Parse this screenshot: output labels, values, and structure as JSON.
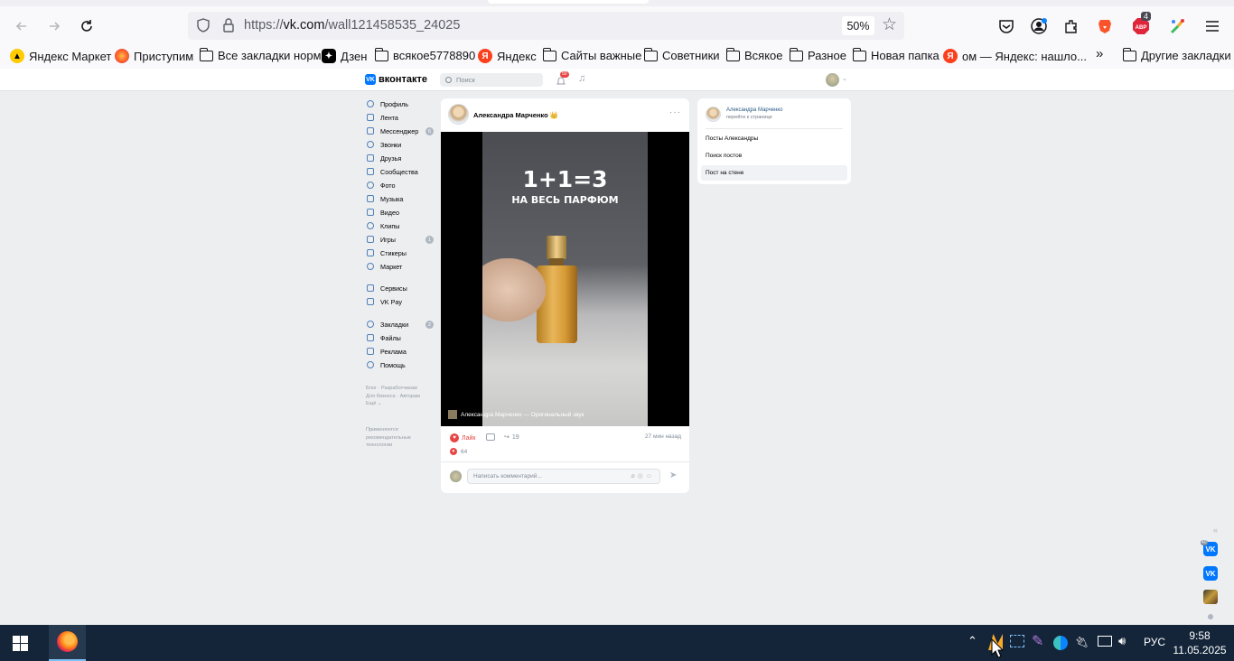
{
  "browser": {
    "url_prefix": "https://",
    "url_domain": "vk.com",
    "url_path": "/wall121458535_24025",
    "zoom": "50%",
    "bookmarks": [
      {
        "label": "Яндекс Маркет",
        "icon": "yandex-market-icon"
      },
      {
        "label": "Приступим",
        "icon": "firefox-icon"
      },
      {
        "label": "Все закладки норм",
        "icon": "folder-icon"
      },
      {
        "label": "Дзен",
        "icon": "dzen-icon"
      },
      {
        "label": "всякое5778890",
        "icon": "folder-icon"
      },
      {
        "label": "Яндекс",
        "icon": "yandex-icon"
      },
      {
        "label": "Сайты важные",
        "icon": "folder-icon"
      },
      {
        "label": "Советники",
        "icon": "folder-icon"
      },
      {
        "label": "Всякое",
        "icon": "folder-icon"
      },
      {
        "label": "Разное",
        "icon": "folder-icon"
      },
      {
        "label": "Новая папка",
        "icon": "folder-icon"
      },
      {
        "label": "ом — Яндекс: нашло...",
        "icon": "yandex-icon"
      }
    ],
    "other_bookmarks": "Другие закладки",
    "toolbar_badge_count": "4"
  },
  "vk": {
    "logo_text": "вконтакте",
    "search_placeholder": "Поиск",
    "notif_badge": "50",
    "menu": [
      {
        "label": "Профиль",
        "icon": "profile-icon"
      },
      {
        "label": "Лента",
        "icon": "feed-icon"
      },
      {
        "label": "Мессенджер",
        "icon": "messenger-icon",
        "count": "6"
      },
      {
        "label": "Звонки",
        "icon": "phone-icon"
      },
      {
        "label": "Друзья",
        "icon": "friends-icon"
      },
      {
        "label": "Сообщества",
        "icon": "communities-icon"
      },
      {
        "label": "Фото",
        "icon": "photo-icon"
      },
      {
        "label": "Музыка",
        "icon": "music-icon"
      },
      {
        "label": "Видео",
        "icon": "video-icon"
      },
      {
        "label": "Клипы",
        "icon": "clips-icon"
      },
      {
        "label": "Игры",
        "icon": "games-icon",
        "count": "1"
      },
      {
        "label": "Стикеры",
        "icon": "stickers-icon"
      },
      {
        "label": "Маркет",
        "icon": "market-icon"
      },
      {
        "label": "Сервисы",
        "icon": "services-icon"
      },
      {
        "label": "VK Pay",
        "icon": "vkpay-icon"
      },
      {
        "label": "Закладки",
        "icon": "bookmarks-icon",
        "count": "2"
      },
      {
        "label": "Файлы",
        "icon": "files-icon"
      },
      {
        "label": "Реклама",
        "icon": "ads-icon"
      },
      {
        "label": "Помощь",
        "icon": "help-icon"
      }
    ],
    "footer_links": "Блог · Разработчикам\nДля бизнеса · Авторам\nЕщё ⌄",
    "footer_note": "Применяются\nрекомендательные\nтехнологии",
    "post": {
      "author": "Александра Марченко",
      "video_title1": "1+1=3",
      "video_title2": "НА ВЕСЬ ПАРФЮМ",
      "audio_caption": "Александра Марченко — Оригинальный звук",
      "like_label": "Лайк",
      "shares": "19",
      "time": "27 мин назад",
      "likes": "64",
      "comment_placeholder": "Написать комментарий..."
    },
    "side": {
      "name": "Александра Марченко",
      "sub": "перейти к странице",
      "items": [
        "Посты Александры",
        "Поиск постов",
        "Пост на стене"
      ]
    },
    "mini_badge": "40"
  },
  "taskbar": {
    "lang": "РУС",
    "time": "9:58",
    "date": "11.05.2025"
  },
  "colors": {
    "vk_blue": "#0077ff",
    "like_red": "#e64646",
    "taskbar": "#14253a"
  }
}
